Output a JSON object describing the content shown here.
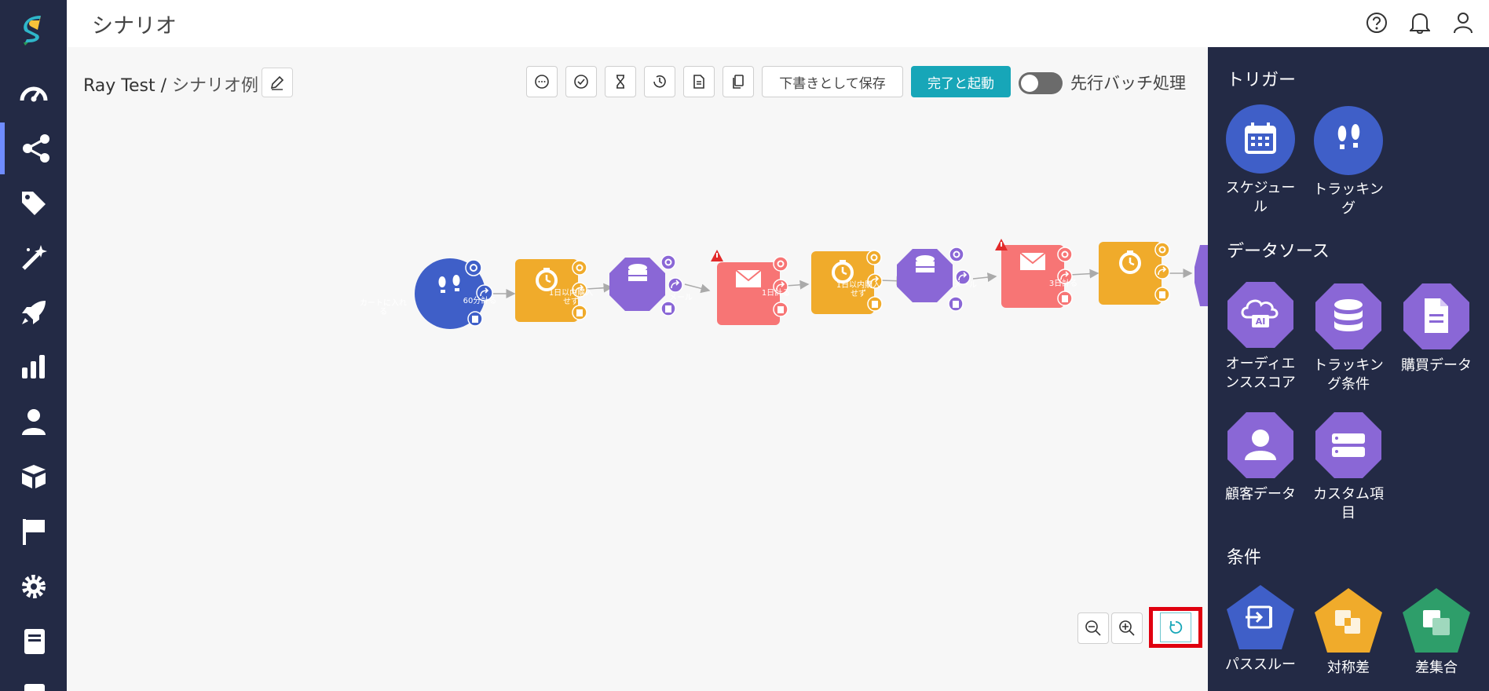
{
  "header": {
    "title": "シナリオ"
  },
  "breadcrumb": {
    "project": "Ray Test",
    "separator": " / ",
    "scenario": "シナリオ例"
  },
  "toolbar": {
    "save_draft_label": "下書きとして保存",
    "launch_label": "完了と起動",
    "batch_label": "先行バッチ処理"
  },
  "flow_nodes": [
    {
      "label": "カートに入れる",
      "type": "tracking",
      "color": "#3f5fc8"
    },
    {
      "label": "60分計る",
      "type": "timer",
      "color": "#f0ab2b"
    },
    {
      "label": "1日以内購入せず",
      "type": "data",
      "color": "#8a67d6"
    },
    {
      "label": "メール",
      "type": "mail",
      "color": "#f77575",
      "warning": true
    },
    {
      "label": "1日計る",
      "type": "timer",
      "color": "#f0ab2b"
    },
    {
      "label": "1日以内購入せず",
      "type": "data",
      "color": "#8a67d6"
    },
    {
      "label": "メール",
      "type": "mail",
      "color": "#f77575",
      "warning": true
    },
    {
      "label": "3日計る",
      "type": "timer",
      "color": "#f0ab2b"
    }
  ],
  "palette": {
    "triggers_title": "トリガー",
    "triggers": [
      {
        "label": "スケジュール",
        "icon": "calendar-icon",
        "color": "#3f5fc8"
      },
      {
        "label": "トラッキング",
        "icon": "footprints-icon",
        "color": "#3f5fc8"
      }
    ],
    "datasource_title": "データソース",
    "datasources": [
      {
        "label": "オーディエンススコア",
        "icon": "ai-cloud-icon",
        "color": "#8a67d6"
      },
      {
        "label": "トラッキング条件",
        "icon": "database-icon",
        "color": "#8a67d6"
      },
      {
        "label": "購買データ",
        "icon": "document-icon",
        "color": "#8a67d6"
      },
      {
        "label": "顧客データ",
        "icon": "person-icon",
        "color": "#8a67d6"
      },
      {
        "label": "カスタム項目",
        "icon": "server-icon",
        "color": "#8a67d6"
      }
    ],
    "conditions_title": "条件",
    "conditions": [
      {
        "label": "パススルー",
        "icon": "passthrough-icon",
        "color": "#3f5fc8"
      },
      {
        "label": "対称差",
        "icon": "symmetric-diff-icon",
        "color": "#f0ab2b"
      },
      {
        "label": "差集合",
        "icon": "difference-icon",
        "color": "#2e9e6a"
      }
    ]
  }
}
